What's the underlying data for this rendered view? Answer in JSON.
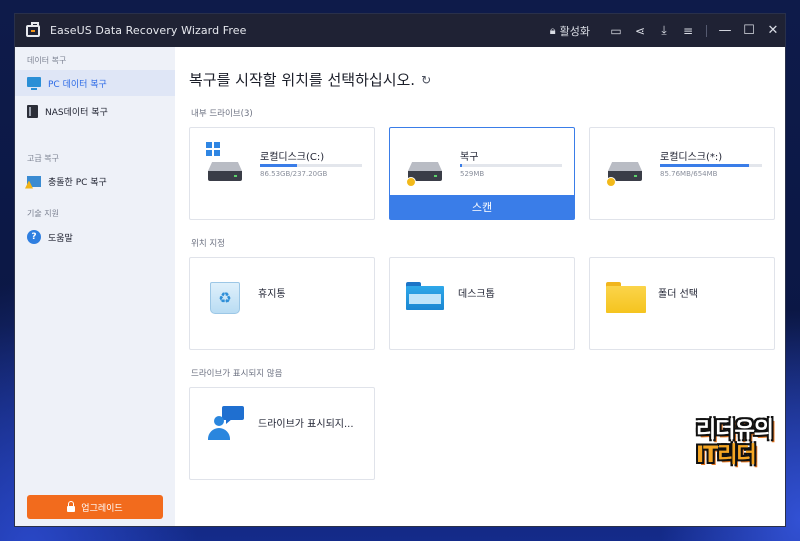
{
  "window": {
    "title": "EaseUS Data Recovery Wizard Free",
    "activate_label": "활성화"
  },
  "sidebar": {
    "sections": [
      {
        "label": "데이터 복구"
      },
      {
        "label": "고급 복구"
      },
      {
        "label": "기술 지원"
      }
    ],
    "items": [
      {
        "label": "PC 데이터 복구",
        "icon": "monitor-icon"
      },
      {
        "label": "NAS데이터 복구",
        "icon": "nas-icon"
      },
      {
        "label": "충돌한 PC 복구",
        "icon": "crashed-pc-icon"
      },
      {
        "label": "도움말",
        "icon": "help-icon"
      }
    ],
    "upgrade_label": "업그레이드"
  },
  "main": {
    "heading": "복구를 시작할 위치를 선택하십시오.",
    "groups": {
      "internal": "내부 드라이브(3)",
      "locations": "위치 지정",
      "missing": "드라이브가 표시되지 않음"
    },
    "drives": [
      {
        "name": "로컬디스크(C:)",
        "size": "86.53GB/237.20GB",
        "used_fraction": 0.365
      },
      {
        "name": "복구",
        "size": "529MB",
        "used_fraction": 0.02
      },
      {
        "name": "로컬디스크(*:)",
        "size": "85.76MB/654MB",
        "used_fraction": 0.87
      }
    ],
    "scan_label": "스캔",
    "locations": [
      {
        "label": "휴지통",
        "icon": "recycle-bin-icon"
      },
      {
        "label": "데스크톱",
        "icon": "desktop-folder-icon"
      },
      {
        "label": "폴더 선택",
        "icon": "folder-icon"
      }
    ],
    "missing_drive_label": "드라이브가 표시되지...",
    "accent": "#3a7de8",
    "upgrade_color": "#f26b1d"
  },
  "watermark": {
    "line1": "리더유의",
    "line2": "IT리더"
  }
}
